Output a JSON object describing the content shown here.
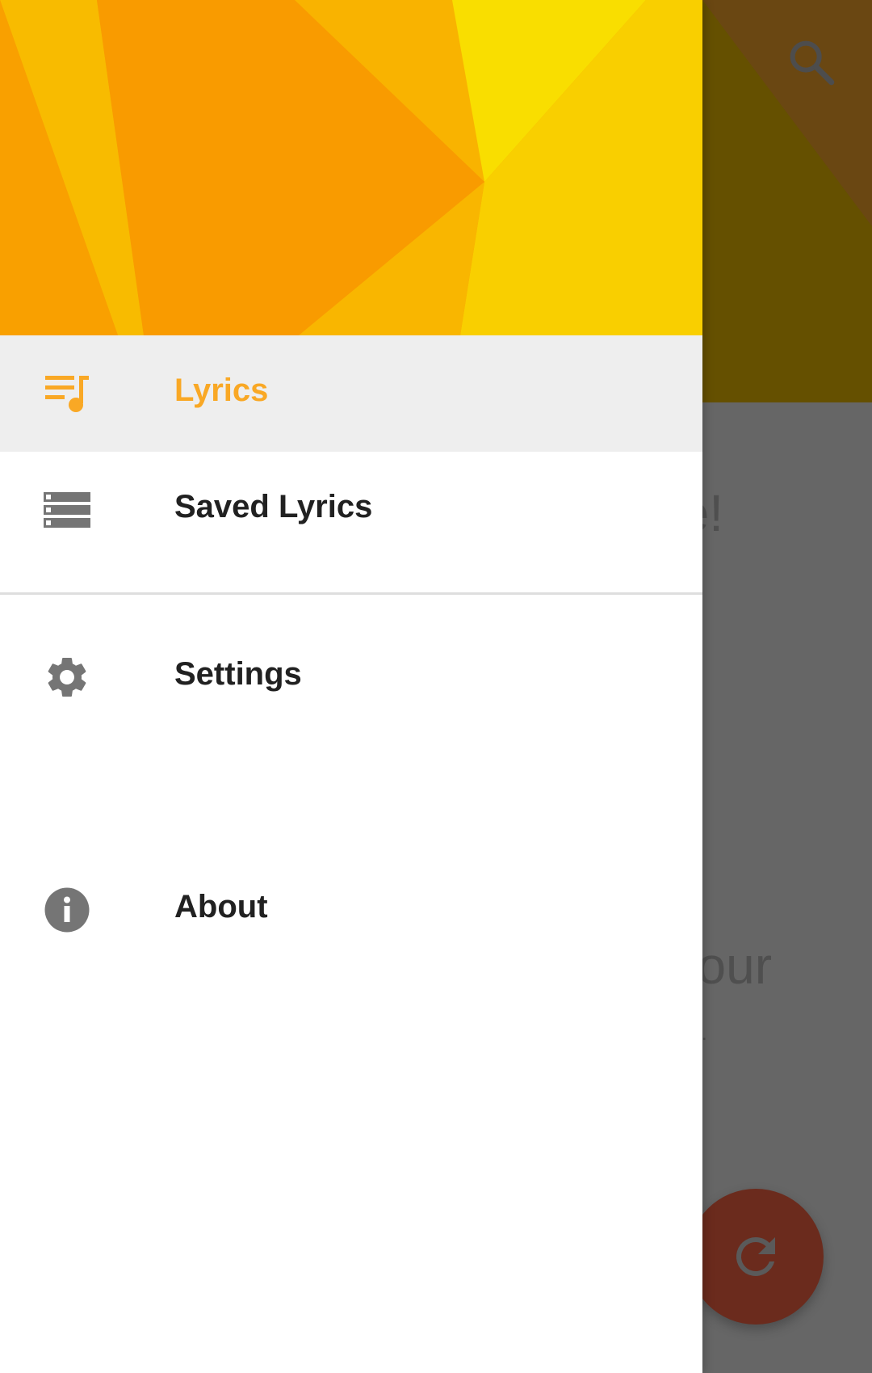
{
  "colors": {
    "accent": "#F9A825",
    "header_yellow": "#F9D000",
    "header_orange": "#F99800",
    "icon_gray": "#757575",
    "text_primary": "#212121",
    "scrim_bg": "#666666",
    "fab": "#6B2B1D"
  },
  "background_app": {
    "title_fragment": "e!",
    "line1_fragment": "our",
    "line2_fragment": ".",
    "search_icon": "search-icon",
    "fab_icon": "refresh-icon"
  },
  "drawer": {
    "items": [
      {
        "label": "Lyrics",
        "icon": "queue-music-icon",
        "active": true
      },
      {
        "label": "Saved Lyrics",
        "icon": "view-list-icon",
        "active": false
      },
      {
        "label": "Settings",
        "icon": "gear-icon",
        "active": false
      },
      {
        "label": "About",
        "icon": "info-icon",
        "active": false
      }
    ]
  }
}
